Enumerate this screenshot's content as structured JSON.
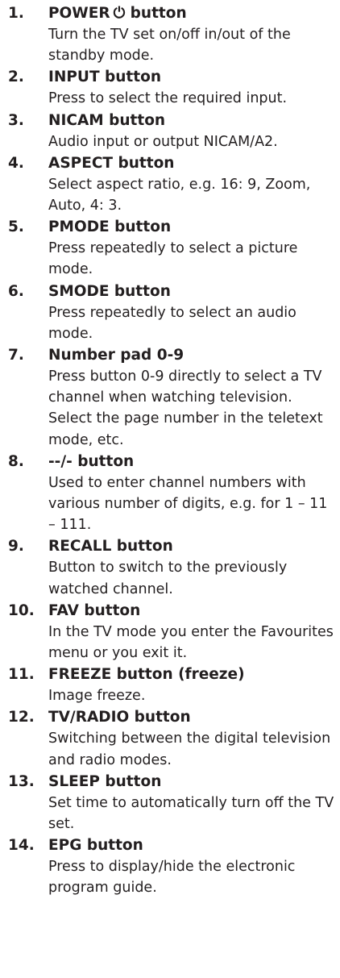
{
  "items": [
    {
      "number": "1.",
      "title": "POWER",
      "icon": "power-icon",
      "icon_glyph": "⏻",
      "suffix": " button",
      "description": "Turn the TV set on/off in/out of the standby mode."
    },
    {
      "number": "2.",
      "title": "INPUT button",
      "description": "Press to select the required input."
    },
    {
      "number": "3.",
      "title": "NICAM button",
      "description": "Audio input or output NICAM/A2."
    },
    {
      "number": "4.",
      "title": "ASPECT button",
      "description": "Select aspect ratio, e.g. 16: 9, Zoom, Auto, 4: 3."
    },
    {
      "number": "5.",
      "title": "PMODE button",
      "description": "Press repeatedly to select a picture mode."
    },
    {
      "number": "6.",
      "title": "SMODE button",
      "description": "Press repeatedly to select an audio mode."
    },
    {
      "number": "7.",
      "title": "Number pad 0-9",
      "description": "Press button 0-9 directly to select a TV channel when watching television. Select the page number in the teletext mode, etc."
    },
    {
      "number": "8.",
      "title": "--/- button",
      "description": "Used to enter channel numbers with various number of digits, e.g. for 1 – 11 – 111."
    },
    {
      "number": "9.",
      "title": "RECALL button",
      "description": "Button to switch to the previously watched channel."
    },
    {
      "number": "10.",
      "title": "FAV button",
      "description": "In the TV mode you enter the Favourites menu or you exit it."
    },
    {
      "number": "11.",
      "title": "FREEZE button (freeze)",
      "description": "Image freeze."
    },
    {
      "number": "12.",
      "title": "TV/RADIO button",
      "description": "Switching between the digital television and radio modes."
    },
    {
      "number": "13.",
      "title": "SLEEP button",
      "description": "Set time to automatically turn off the TV set."
    },
    {
      "number": "14.",
      "title": "EPG button",
      "description": "Press to display/hide the electronic program guide."
    }
  ]
}
